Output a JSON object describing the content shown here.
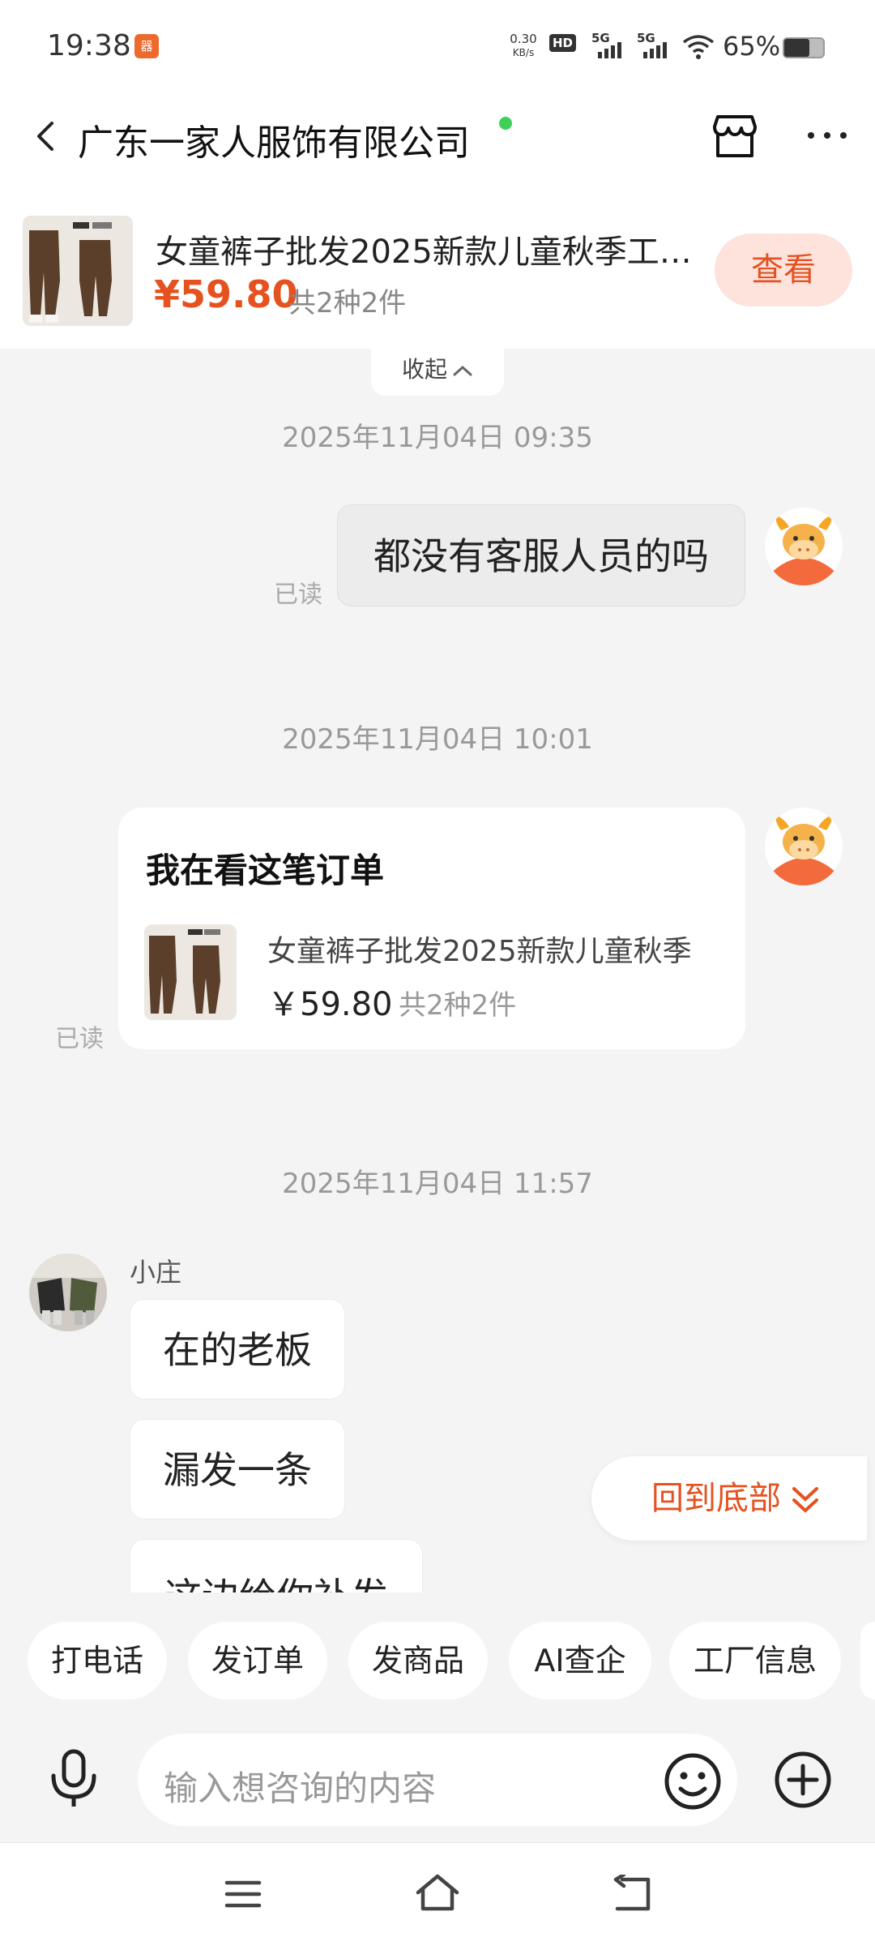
{
  "status_bar": {
    "time": "19:38",
    "app_icon_text": "器",
    "net_speed_value": "0.30",
    "net_speed_unit": "KB/s",
    "hd": "HD",
    "sim1": "5G",
    "sim2": "5G",
    "battery": "65%",
    "battery_level": 0.65
  },
  "header": {
    "title": "广东一家人服饰有限公司",
    "online_color": "#3fd05a"
  },
  "product": {
    "name": "女童裤子批发2025新款儿童秋季工…",
    "price": "¥59.80",
    "quantity": "共2种2件",
    "view_label": "查看"
  },
  "collapse_label": "收起",
  "messages": {
    "ts1": "2025年11月04日 09:35",
    "msg1": "都没有客服人员的吗",
    "read1": "已读",
    "ts2": "2025年11月04日 10:01",
    "order_card": {
      "title": "我在看这笔订单",
      "name": "女童裤子批发2025新款儿童秋季",
      "price": "￥59.80",
      "quantity": "共2种2件"
    },
    "read2": "已读",
    "ts3": "2025年11月04日 11:57",
    "sender": "小庄",
    "reply1": "在的老板",
    "reply2": "漏发一条",
    "reply3": "这边给你补发"
  },
  "back_to_bottom": "回到底部",
  "quick_actions": [
    "打电话",
    "发订单",
    "发商品",
    "AI查企",
    "工厂信息"
  ],
  "input": {
    "placeholder": "输入想咨询的内容"
  },
  "accent_color": "#e5511f"
}
